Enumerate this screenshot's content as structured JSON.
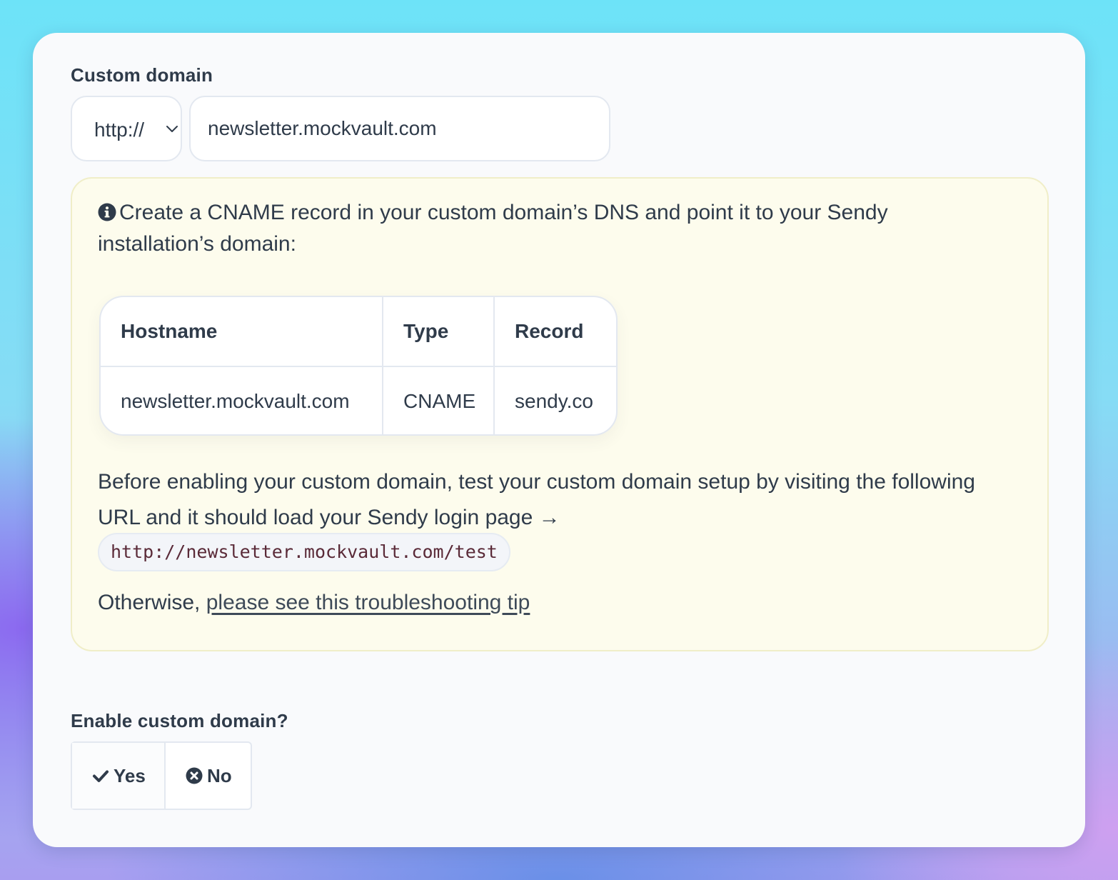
{
  "custom_domain": {
    "label": "Custom domain",
    "protocol_select": {
      "value": "http://"
    },
    "domain_input": {
      "value": "newsletter.mockvault.com"
    }
  },
  "notice": {
    "intro_text": "Create a CNAME record in your custom domain’s DNS and point it to your Sendy installation’s domain:",
    "dns_table": {
      "headers": [
        "Hostname",
        "Type",
        "Record"
      ],
      "rows": [
        [
          "newsletter.mockvault.com",
          "CNAME",
          "sendy.co"
        ]
      ]
    },
    "before_text": "Before enabling your custom domain, test your custom domain setup by visiting the following URL and it should load your Sendy login page →",
    "test_url": "http://newsletter.mockvault.com/test",
    "otherwise_prefix": "Otherwise,",
    "troubleshooting_link": "please see this troubleshooting tip"
  },
  "enable": {
    "label": "Enable custom domain?",
    "yes_label": "Yes",
    "no_label": "No"
  },
  "icons": {
    "info": "info-circle-icon",
    "chevron": "chevron-down-icon",
    "yes": "checkmark-icon",
    "no": "x-circle-icon"
  }
}
